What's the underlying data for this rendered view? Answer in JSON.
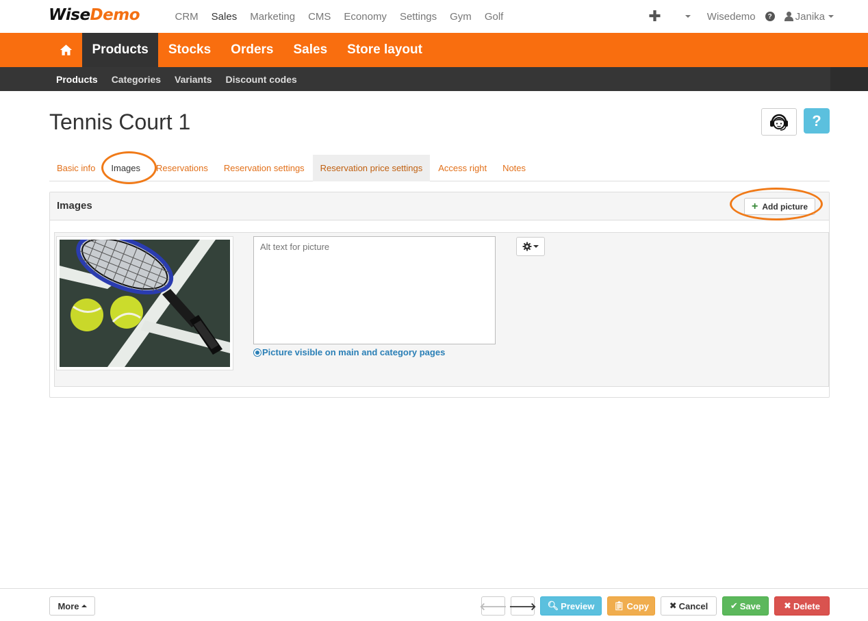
{
  "brand": {
    "part1": "Wise",
    "part2": "Demo"
  },
  "top_nav": [
    {
      "label": "CRM",
      "active": false
    },
    {
      "label": "Sales",
      "active": true
    },
    {
      "label": "Marketing",
      "active": false
    },
    {
      "label": "CMS",
      "active": false
    },
    {
      "label": "Economy",
      "active": false
    },
    {
      "label": "Settings",
      "active": false
    },
    {
      "label": "Gym",
      "active": false
    },
    {
      "label": "Golf",
      "active": false
    }
  ],
  "top_right": {
    "company": "Wisedemo",
    "user": "Janika"
  },
  "main_nav": [
    {
      "label": "Products",
      "active": true
    },
    {
      "label": "Stocks",
      "active": false
    },
    {
      "label": "Orders",
      "active": false
    },
    {
      "label": "Sales",
      "active": false
    },
    {
      "label": "Store layout",
      "active": false
    }
  ],
  "sub_nav": [
    {
      "label": "Products",
      "active": true
    },
    {
      "label": "Categories",
      "active": false
    },
    {
      "label": "Variants",
      "active": false
    },
    {
      "label": "Discount codes",
      "active": false
    }
  ],
  "page": {
    "title": "Tennis Court 1",
    "help_label": "?"
  },
  "tabs": [
    {
      "label": "Basic info"
    },
    {
      "label": "Images"
    },
    {
      "label": "Reservations"
    },
    {
      "label": "Reservation settings"
    },
    {
      "label": "Reservation price settings"
    },
    {
      "label": "Access right"
    },
    {
      "label": "Notes"
    }
  ],
  "images_panel": {
    "title": "Images",
    "add_label": "Add picture",
    "alt_placeholder": "Alt text for picture",
    "alt_value": "",
    "visible_label": "Picture visible on main and category pages"
  },
  "footer": {
    "more": "More",
    "preview": "Preview",
    "copy": "Copy",
    "cancel": "Cancel",
    "save": "Save",
    "delete": "Delete"
  },
  "colors": {
    "accent": "#f96e0f",
    "dark": "#363636",
    "link": "#e2701a",
    "info": "#5bc0de",
    "success": "#5cb85c",
    "danger": "#d9534f",
    "warning": "#f0ad4e"
  }
}
